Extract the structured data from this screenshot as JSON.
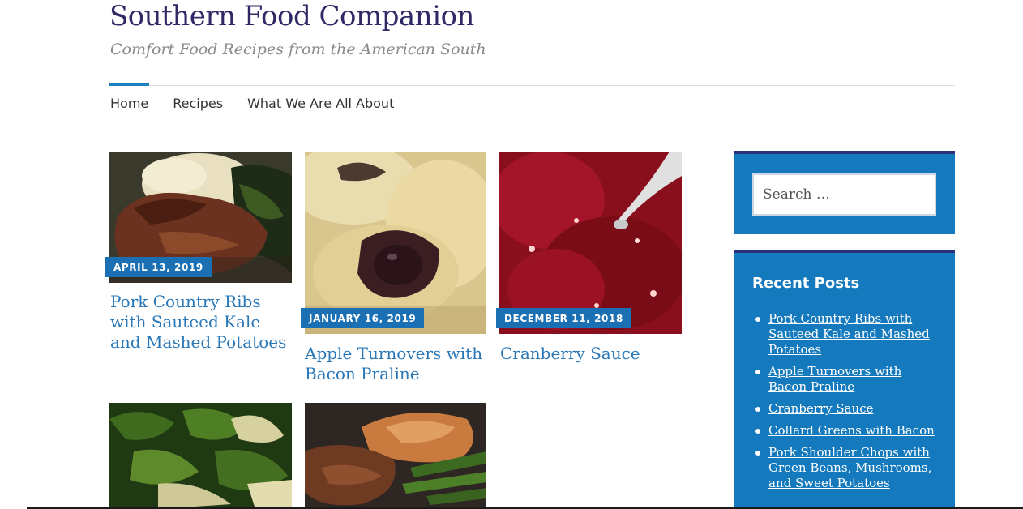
{
  "site": {
    "title": "Southern Food Companion",
    "tagline": "Comfort Food Recipes from the American South"
  },
  "nav": {
    "items": [
      "Home",
      "Recipes",
      "What We Are All About"
    ],
    "active": "Home",
    "accent_color": "#1e7fc0"
  },
  "posts": [
    {
      "date": "APRIL 13, 2019",
      "title": "Pork Country Ribs with Sauteed Kale and Mashed Potatoes",
      "image": "pork-ribs-photo"
    },
    {
      "date": "JANUARY 16, 2019",
      "title": "Apple Turnovers with Bacon Praline",
      "image": "apple-turnover-photo"
    },
    {
      "date": "DECEMBER 11, 2018",
      "title": "Cranberry Sauce",
      "image": "cranberry-sauce-photo"
    },
    {
      "date": "",
      "title": "",
      "image": "collard-greens-photo"
    },
    {
      "date": "",
      "title": "",
      "image": "pork-chops-sweet-potato-photo"
    }
  ],
  "sidebar": {
    "search": {
      "placeholder": "Search …"
    },
    "recent_posts": {
      "heading": "Recent Posts",
      "items": [
        "Pork Country Ribs with Sauteed Kale and Mashed Potatoes",
        "Apple Turnovers with Bacon Praline",
        "Cranberry Sauce",
        "Collard Greens with Bacon",
        "Pork Shoulder Chops with Green Beans, Mushrooms, and Sweet Potatoes"
      ]
    },
    "widget_color": "#1479bd",
    "widget_border_color": "#2c2f7a"
  },
  "colors": {
    "title": "#2f2a66",
    "post_title": "#2a78b8",
    "date_badge": "#1b6fb3"
  }
}
